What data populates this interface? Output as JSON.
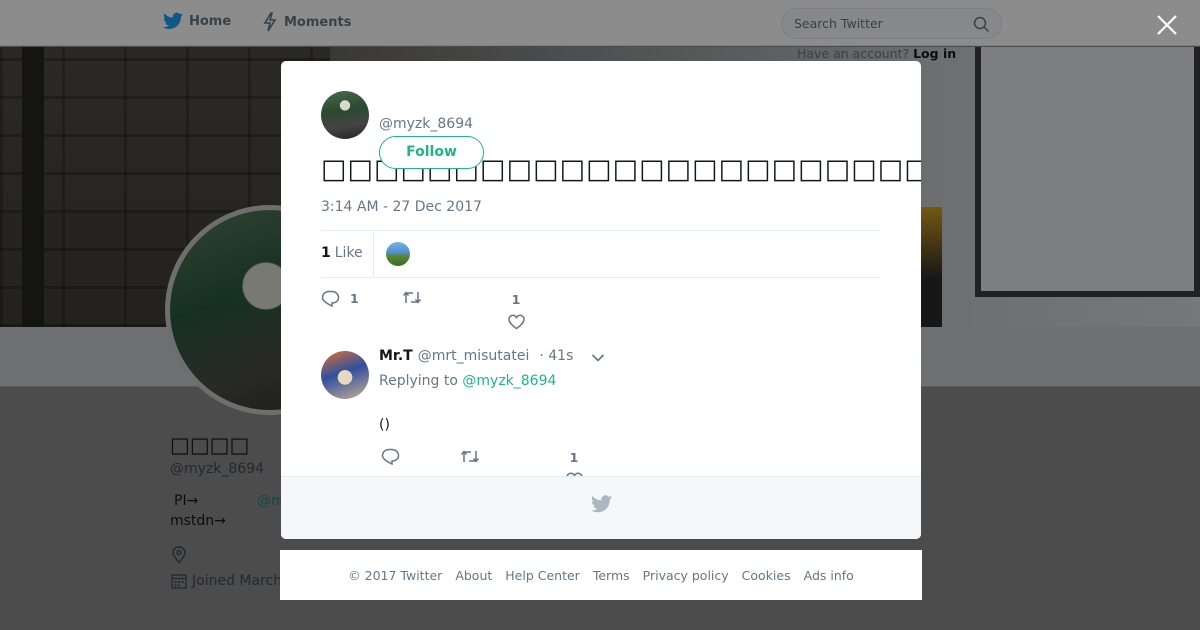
{
  "nav": {
    "home_label": "Home",
    "moments_label": "Moments",
    "search_placeholder": "Search Twitter",
    "have_account_text": "Have an account?",
    "login_label": "Log in"
  },
  "profile_bg": {
    "name": "□□□□",
    "handle": "@myzk_8694",
    "bio_line1": "PI→",
    "bio_link": "@m",
    "bio_line2": "mstdn→",
    "joined_text": "Joined March"
  },
  "tweet": {
    "author_handle": "@myzk_8694",
    "follow_label": "Follow",
    "text": "□□□□□□□□□□□□□□□□□□□□□□□□□□□□□□□□□□",
    "timestamp": "3:14 AM - 27 Dec 2017",
    "like_count": "1",
    "like_label": "Like",
    "actions": {
      "reply_count": "1",
      "retweet_count": "",
      "like_count": "1"
    }
  },
  "reply": {
    "fullname": "Mr.T",
    "handle": "@mrt_misutatei",
    "time": "· 41s",
    "replying_to_label": "Replying to",
    "replying_to_handle": "@myzk_8694",
    "text": "()",
    "actions": {
      "like_count": "1"
    }
  },
  "footer": {
    "links": [
      "© 2017 Twitter",
      "About",
      "Help Center",
      "Terms",
      "Privacy policy",
      "Cookies",
      "Ads info"
    ]
  },
  "colors": {
    "accent": "#1fb589",
    "twitter_blue": "#1da1f2",
    "muted": "#657786"
  }
}
